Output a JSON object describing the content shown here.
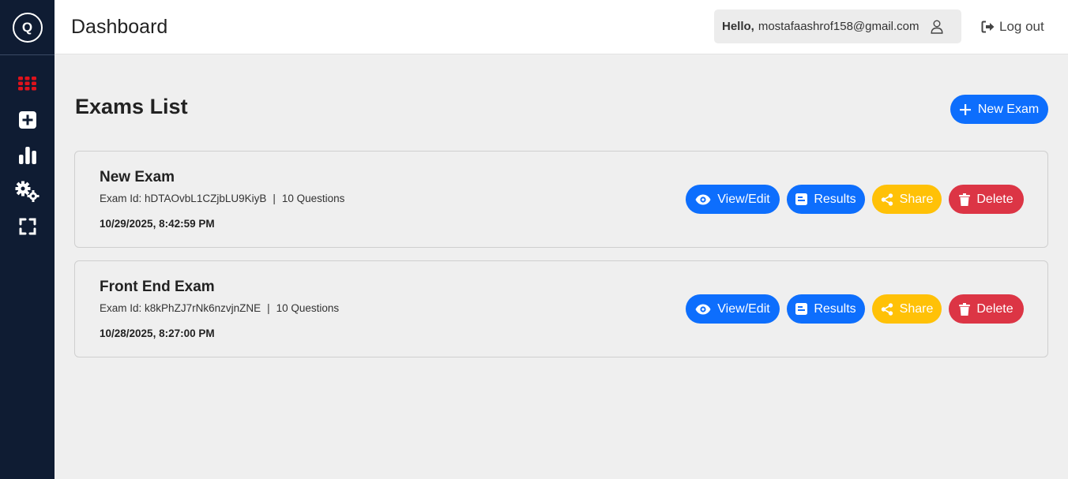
{
  "sidebar": {
    "logo_letter": "Q",
    "items": [
      {
        "name": "grid-icon",
        "color": "#e0121b"
      },
      {
        "name": "add-square-icon",
        "color": "#ffffff"
      },
      {
        "name": "bar-chart-icon",
        "color": "#ffffff"
      },
      {
        "name": "gears-icon",
        "color": "#ffffff"
      },
      {
        "name": "fullscreen-icon",
        "color": "#ffffff"
      }
    ]
  },
  "header": {
    "title": "Dashboard",
    "hello_label": "Hello,",
    "email": "mostafaashrof158@gmail.com",
    "logout_label": "Log out"
  },
  "main": {
    "title": "Exams List",
    "new_exam_label": "New Exam"
  },
  "exams": [
    {
      "title": "New Exam",
      "id_label": "Exam Id:",
      "id": "hDTAOvbL1CZjbLU9KiyB",
      "questions": "10 Questions",
      "date": "10/29/2025, 8:42:59 PM"
    },
    {
      "title": "Front End Exam",
      "id_label": "Exam Id:",
      "id": "k8kPhZJ7rNk6nzvjnZNE",
      "questions": "10 Questions",
      "date": "10/28/2025, 8:27:00 PM"
    }
  ],
  "actions": {
    "view_label": "View/Edit",
    "results_label": "Results",
    "share_label": "Share",
    "delete_label": "Delete"
  },
  "colors": {
    "sidebar_bg": "#0f1c33",
    "primary": "#0d6efd",
    "warning": "#ffc107",
    "danger": "#dc3545",
    "active_nav": "#e0121b"
  }
}
